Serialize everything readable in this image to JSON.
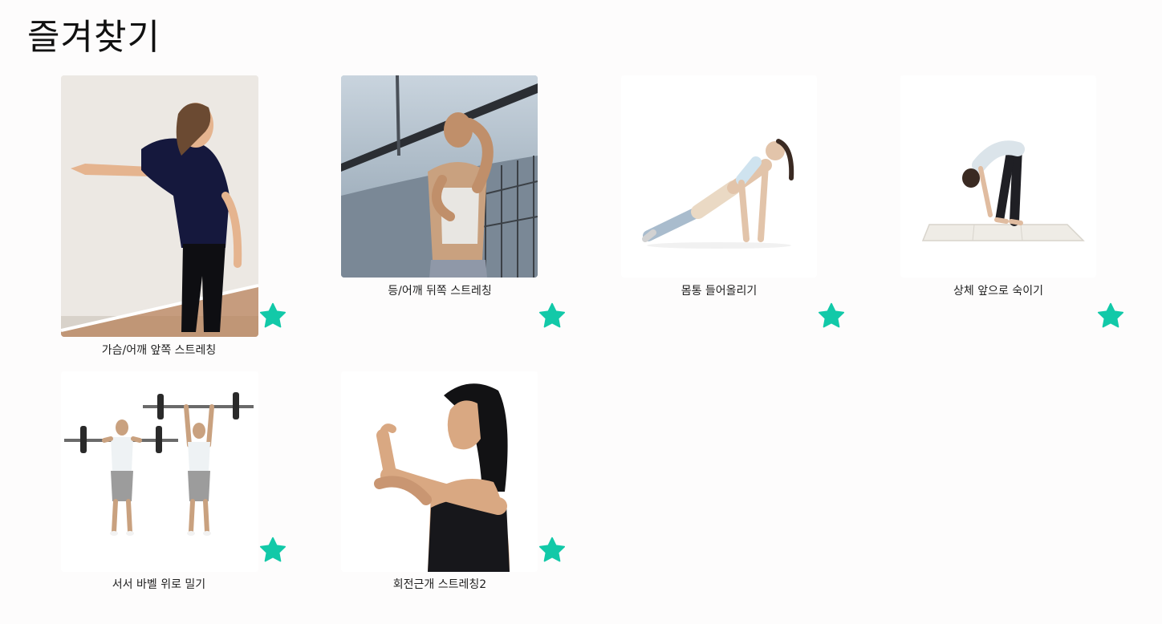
{
  "page": {
    "title": "즐겨찾기"
  },
  "theme": {
    "star_color": "#12c9a8"
  },
  "favorites": [
    {
      "label": "가슴/어깨 앞쪽 스트레칭",
      "image_icon": "wall-chest-stretch-photo",
      "starred": true
    },
    {
      "label": "등/어깨 뒤쪽 스트레칭",
      "image_icon": "bridge-back-stretch-photo",
      "starred": true
    },
    {
      "label": "몸통 들어올리기",
      "image_icon": "reverse-plank-photo",
      "starred": true
    },
    {
      "label": "상체 앞으로 숙이기",
      "image_icon": "forward-fold-photo",
      "starred": true
    },
    {
      "label": "서서 바벨 위로 밀기",
      "image_icon": "barbell-press-photo",
      "starred": true
    },
    {
      "label": "회전근개 스트레칭2",
      "image_icon": "rotator-cuff-stretch-photo",
      "starred": true
    }
  ]
}
